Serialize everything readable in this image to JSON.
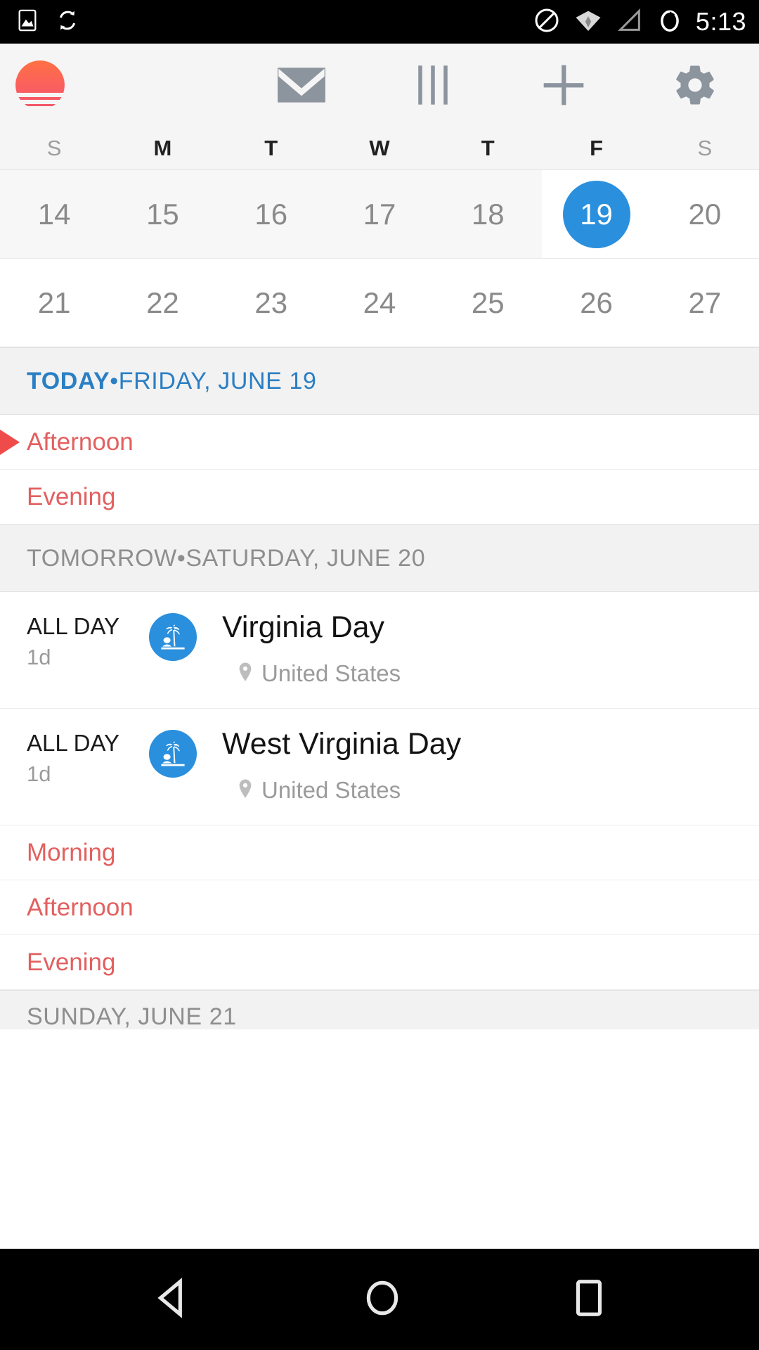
{
  "statusbar": {
    "time": "5:13",
    "icons": [
      "image-icon",
      "sync-icon",
      "do-not-disturb-icon",
      "wifi-icon",
      "cellular-signal-icon",
      "battery-charging-icon"
    ]
  },
  "toolbar": {
    "logo": "sunrise-calendar-logo",
    "buttons": [
      {
        "name": "mail-icon",
        "label": "Mail"
      },
      {
        "name": "view-columns-icon",
        "label": "Day view"
      },
      {
        "name": "plus-icon",
        "label": "New event"
      },
      {
        "name": "gear-icon",
        "label": "Settings"
      }
    ]
  },
  "calendar": {
    "weekdays": [
      {
        "label": "S",
        "weekend": true
      },
      {
        "label": "M",
        "weekend": false
      },
      {
        "label": "T",
        "weekend": false
      },
      {
        "label": "W",
        "weekend": false
      },
      {
        "label": "T",
        "weekend": false
      },
      {
        "label": "F",
        "weekend": false
      },
      {
        "label": "S",
        "weekend": true
      }
    ],
    "weeks": [
      {
        "days": [
          {
            "num": "14",
            "state": "past"
          },
          {
            "num": "15",
            "state": "past"
          },
          {
            "num": "16",
            "state": "past"
          },
          {
            "num": "17",
            "state": "past"
          },
          {
            "num": "18",
            "state": "past"
          },
          {
            "num": "19",
            "state": "today"
          },
          {
            "num": "20",
            "state": "future"
          }
        ]
      },
      {
        "days": [
          {
            "num": "21",
            "state": "future"
          },
          {
            "num": "22",
            "state": "future"
          },
          {
            "num": "23",
            "state": "future"
          },
          {
            "num": "24",
            "state": "future"
          },
          {
            "num": "25",
            "state": "future"
          },
          {
            "num": "26",
            "state": "future"
          },
          {
            "num": "27",
            "state": "future"
          }
        ]
      }
    ],
    "today_accent_color": "#2a8fdd"
  },
  "agenda": {
    "today_header": {
      "prefix": "TODAY",
      "separator": " • ",
      "date": "FRIDAY, JUNE 19"
    },
    "today_slots": [
      {
        "label": "Afternoon",
        "current": true
      },
      {
        "label": "Evening",
        "current": false
      }
    ],
    "tomorrow_header": {
      "prefix": "TOMORROW",
      "separator": " • ",
      "date": "SATURDAY, JUNE 20"
    },
    "tomorrow_events": [
      {
        "time": "ALL DAY",
        "duration": "1d",
        "icon": "palm-tree-holiday-icon",
        "title": "Virginia Day",
        "location": "United States"
      },
      {
        "time": "ALL DAY",
        "duration": "1d",
        "icon": "palm-tree-holiday-icon",
        "title": "West Virginia Day",
        "location": "United States"
      }
    ],
    "tomorrow_slots": [
      {
        "label": "Morning"
      },
      {
        "label": "Afternoon"
      },
      {
        "label": "Evening"
      }
    ],
    "next_header": {
      "date": "SUNDAY, JUNE 21"
    },
    "slot_color": "#e2605f",
    "now_marker_color": "#ef4b4b"
  },
  "navbar": {
    "buttons": [
      {
        "name": "back-button",
        "label": "Back"
      },
      {
        "name": "home-button",
        "label": "Home"
      },
      {
        "name": "recents-button",
        "label": "Recents"
      }
    ]
  }
}
